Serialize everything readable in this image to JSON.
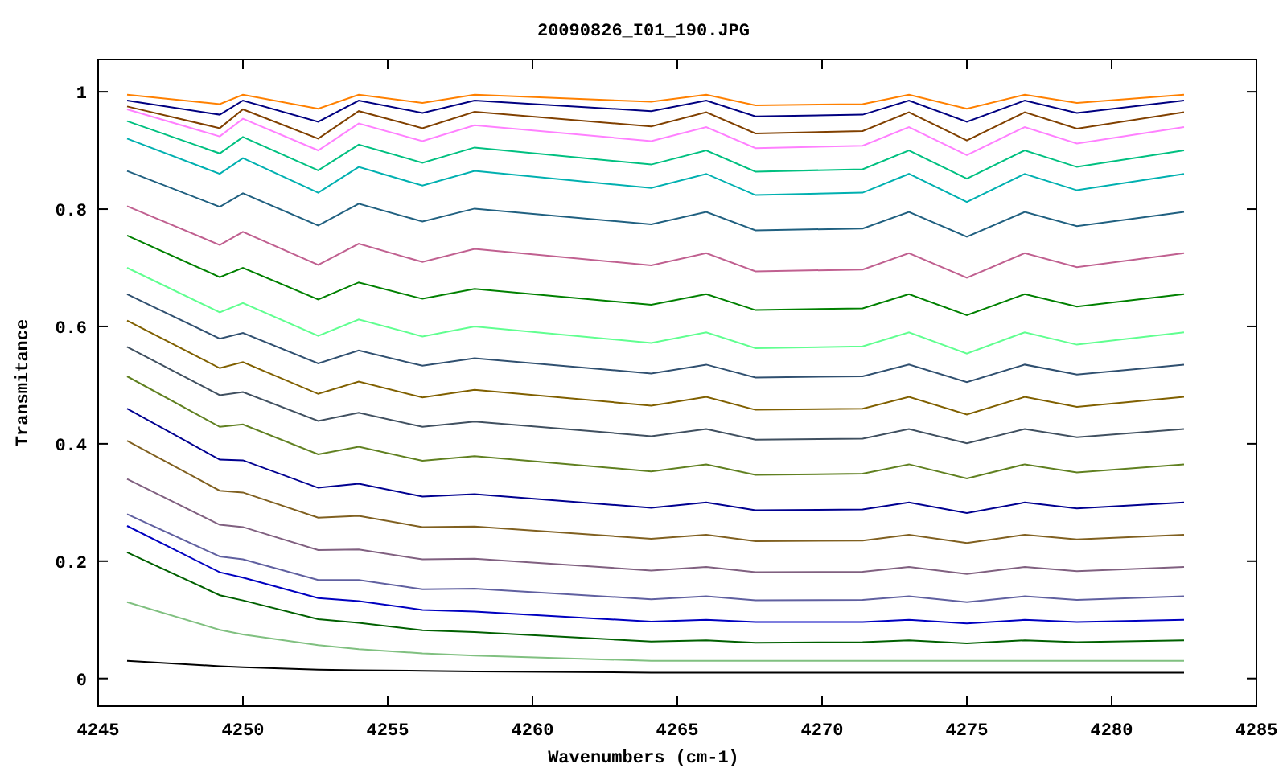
{
  "chart_data": {
    "type": "line",
    "title": "20090826_I01_190.JPG",
    "xlabel": "Wavenumbers (cm-1)",
    "ylabel": "Transmitance",
    "xlim": [
      4245,
      4285
    ],
    "ylim": [
      -0.047,
      1.055
    ],
    "xticks": [
      4245,
      4250,
      4255,
      4260,
      4265,
      4270,
      4275,
      4280,
      4285
    ],
    "yticks": [
      0,
      0.2,
      0.4,
      0.6,
      0.8,
      1
    ],
    "x": [
      4246,
      4249.2,
      4250,
      4252.6,
      4254,
      4256.2,
      4258,
      4264.1,
      4266,
      4267.7,
      4271.4,
      4273,
      4275,
      4277,
      4278.8,
      4282.5
    ],
    "series": [
      {
        "color": "#ff8000",
        "values": [
          0.995,
          0.979,
          0.995,
          0.971,
          0.995,
          0.981,
          0.995,
          0.983,
          0.995,
          0.977,
          0.979,
          0.995,
          0.971,
          0.995,
          0.981,
          0.995
        ]
      },
      {
        "color": "#000080",
        "values": [
          0.985,
          0.961,
          0.985,
          0.949,
          0.985,
          0.964,
          0.985,
          0.967,
          0.985,
          0.958,
          0.961,
          0.985,
          0.949,
          0.985,
          0.964,
          0.985
        ]
      },
      {
        "color": "#804000",
        "values": [
          0.975,
          0.938,
          0.97,
          0.92,
          0.967,
          0.938,
          0.966,
          0.941,
          0.965,
          0.929,
          0.933,
          0.965,
          0.917,
          0.965,
          0.937,
          0.965
        ]
      },
      {
        "color": "#ff80ff",
        "values": [
          0.97,
          0.924,
          0.954,
          0.9,
          0.946,
          0.916,
          0.943,
          0.916,
          0.94,
          0.904,
          0.908,
          0.94,
          0.892,
          0.94,
          0.912,
          0.94
        ]
      },
      {
        "color": "#00c080",
        "values": [
          0.95,
          0.895,
          0.923,
          0.866,
          0.91,
          0.879,
          0.905,
          0.876,
          0.9,
          0.864,
          0.868,
          0.9,
          0.852,
          0.9,
          0.872,
          0.9
        ]
      },
      {
        "color": "#00b0b0",
        "values": [
          0.92,
          0.86,
          0.887,
          0.828,
          0.872,
          0.84,
          0.865,
          0.836,
          0.86,
          0.824,
          0.828,
          0.86,
          0.812,
          0.86,
          0.832,
          0.86
        ]
      },
      {
        "color": "#206080",
        "values": [
          0.865,
          0.804,
          0.827,
          0.772,
          0.809,
          0.779,
          0.801,
          0.774,
          0.795,
          0.764,
          0.767,
          0.795,
          0.753,
          0.795,
          0.771,
          0.795
        ]
      },
      {
        "color": "#c06090",
        "values": [
          0.805,
          0.739,
          0.761,
          0.705,
          0.741,
          0.71,
          0.732,
          0.704,
          0.725,
          0.694,
          0.697,
          0.725,
          0.683,
          0.725,
          0.701,
          0.725
        ]
      },
      {
        "color": "#008000",
        "values": [
          0.755,
          0.684,
          0.7,
          0.646,
          0.675,
          0.647,
          0.664,
          0.637,
          0.655,
          0.628,
          0.631,
          0.655,
          0.619,
          0.655,
          0.634,
          0.655
        ]
      },
      {
        "color": "#60ff90",
        "values": [
          0.7,
          0.624,
          0.64,
          0.584,
          0.612,
          0.583,
          0.6,
          0.572,
          0.59,
          0.563,
          0.566,
          0.59,
          0.554,
          0.59,
          0.569,
          0.59
        ]
      },
      {
        "color": "#305070",
        "values": [
          0.655,
          0.579,
          0.589,
          0.537,
          0.559,
          0.533,
          0.546,
          0.52,
          0.535,
          0.513,
          0.515,
          0.535,
          0.505,
          0.535,
          0.518,
          0.535
        ]
      },
      {
        "color": "#806000",
        "values": [
          0.61,
          0.529,
          0.539,
          0.485,
          0.506,
          0.479,
          0.492,
          0.465,
          0.48,
          0.458,
          0.46,
          0.48,
          0.45,
          0.48,
          0.463,
          0.48
        ]
      },
      {
        "color": "#405060",
        "values": [
          0.565,
          0.483,
          0.488,
          0.439,
          0.453,
          0.429,
          0.438,
          0.413,
          0.425,
          0.407,
          0.409,
          0.425,
          0.401,
          0.425,
          0.411,
          0.425
        ]
      },
      {
        "color": "#608020",
        "values": [
          0.515,
          0.429,
          0.433,
          0.382,
          0.395,
          0.371,
          0.379,
          0.353,
          0.365,
          0.347,
          0.349,
          0.365,
          0.341,
          0.365,
          0.351,
          0.365
        ]
      },
      {
        "color": "#000090",
        "values": [
          0.46,
          0.373,
          0.372,
          0.325,
          0.332,
          0.31,
          0.314,
          0.291,
          0.3,
          0.287,
          0.288,
          0.3,
          0.282,
          0.3,
          0.29,
          0.3
        ]
      },
      {
        "color": "#806020",
        "values": [
          0.405,
          0.32,
          0.317,
          0.274,
          0.277,
          0.258,
          0.259,
          0.238,
          0.245,
          0.234,
          0.235,
          0.245,
          0.231,
          0.245,
          0.237,
          0.245
        ]
      },
      {
        "color": "#806080",
        "values": [
          0.34,
          0.262,
          0.258,
          0.219,
          0.22,
          0.203,
          0.204,
          0.184,
          0.19,
          0.181,
          0.182,
          0.19,
          0.178,
          0.19,
          0.183,
          0.19
        ]
      },
      {
        "color": "#6060a0",
        "values": [
          0.28,
          0.208,
          0.203,
          0.168,
          0.168,
          0.152,
          0.153,
          0.135,
          0.14,
          0.133,
          0.134,
          0.14,
          0.13,
          0.14,
          0.134,
          0.14
        ]
      },
      {
        "color": "#0000c0",
        "values": [
          0.26,
          0.181,
          0.172,
          0.137,
          0.132,
          0.117,
          0.114,
          0.097,
          0.1,
          0.096,
          0.096,
          0.1,
          0.094,
          0.1,
          0.096,
          0.1
        ]
      },
      {
        "color": "#006000",
        "values": [
          0.215,
          0.142,
          0.133,
          0.101,
          0.095,
          0.082,
          0.079,
          0.063,
          0.065,
          0.061,
          0.062,
          0.065,
          0.06,
          0.065,
          0.062,
          0.065
        ]
      },
      {
        "color": "#80c080",
        "values": [
          0.13,
          0.083,
          0.075,
          0.057,
          0.05,
          0.043,
          0.039,
          0.03,
          0.03,
          0.03,
          0.03,
          0.03,
          0.03,
          0.03,
          0.03,
          0.03
        ]
      },
      {
        "color": "#000000",
        "values": [
          0.03,
          0.021,
          0.019,
          0.015,
          0.014,
          0.013,
          0.012,
          0.01,
          0.01,
          0.01,
          0.01,
          0.01,
          0.01,
          0.01,
          0.01,
          0.01
        ]
      }
    ]
  }
}
